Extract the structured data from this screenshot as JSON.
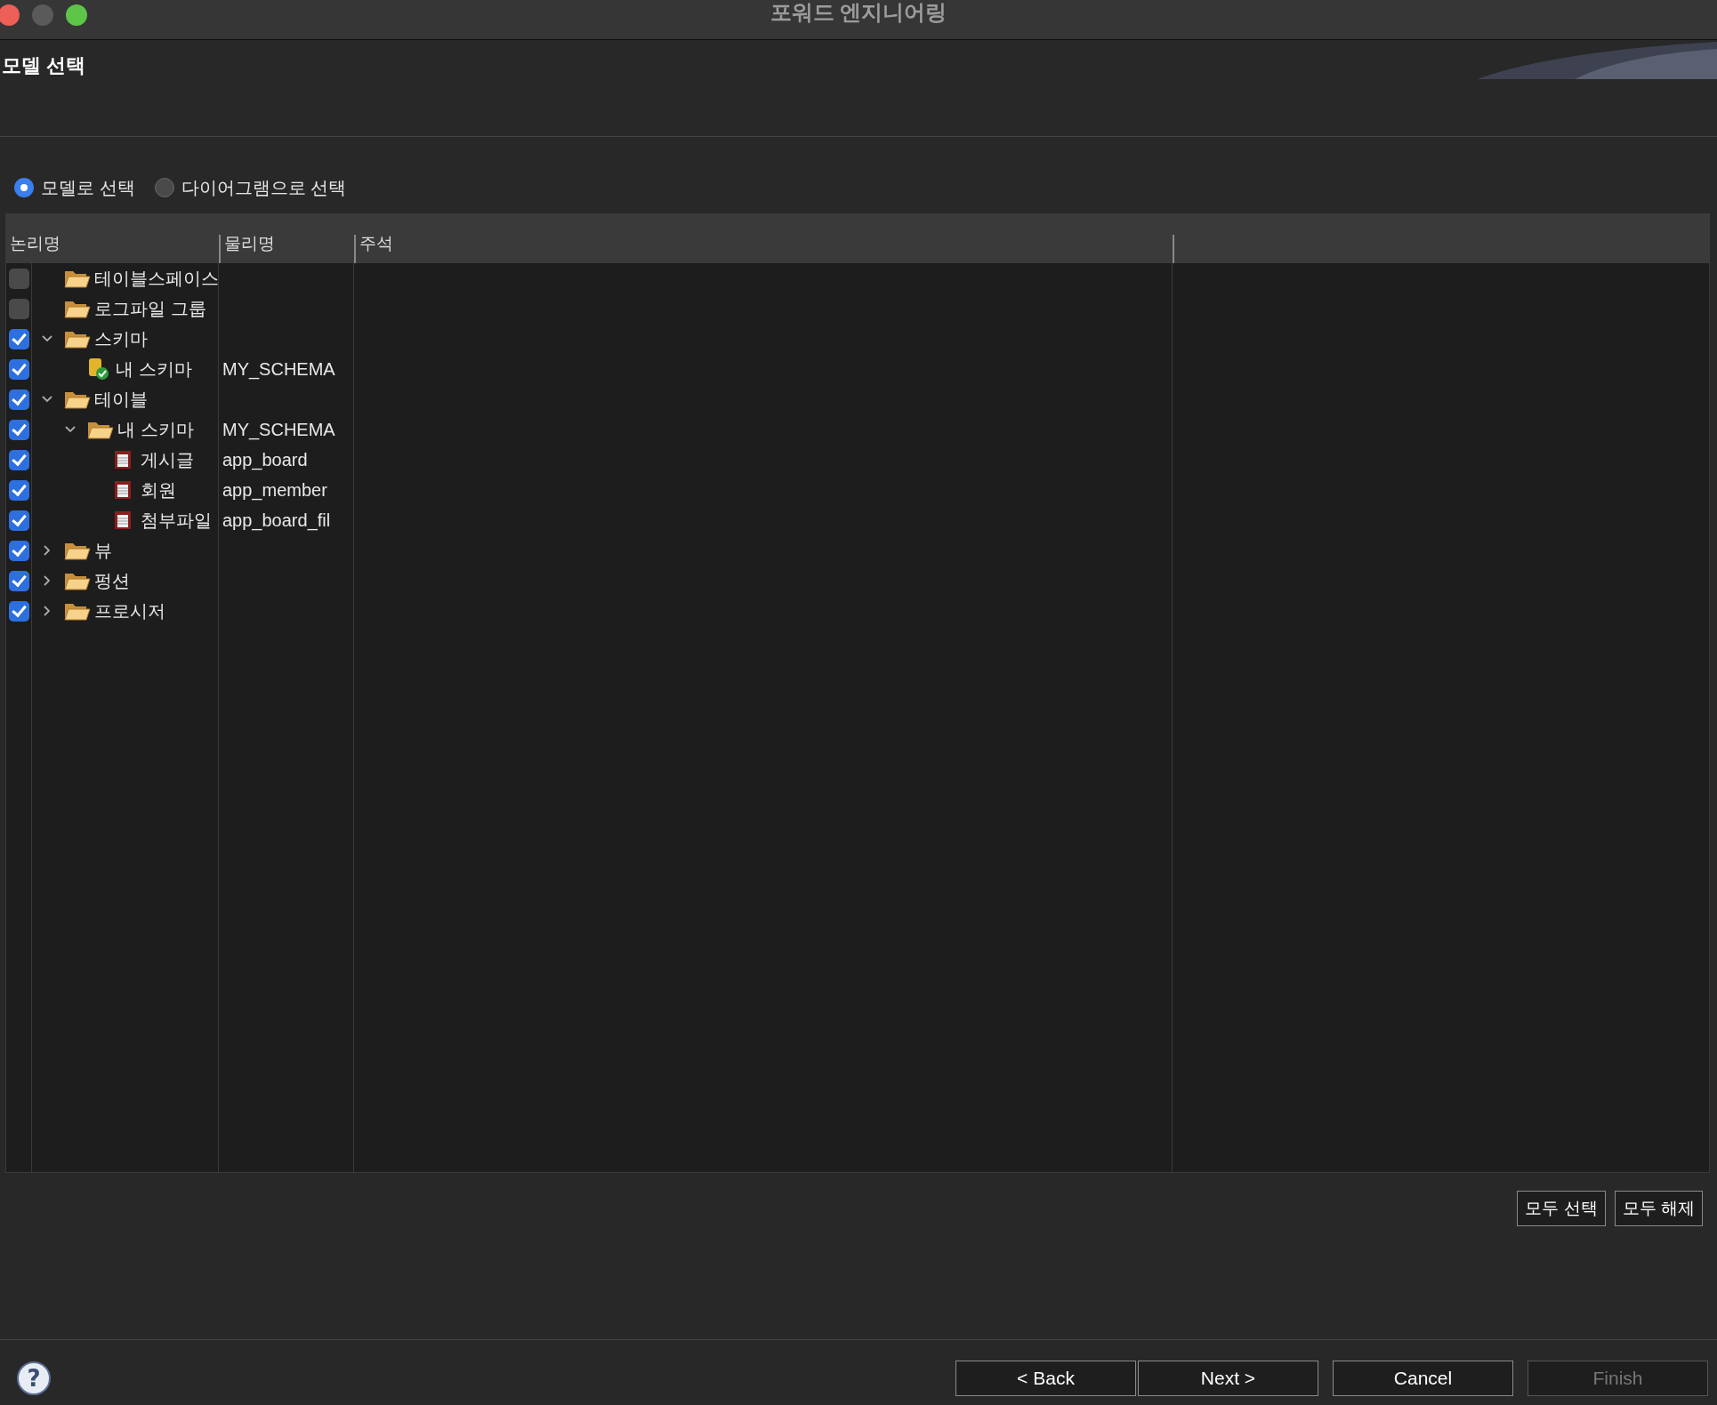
{
  "window": {
    "title": "포워드 엔지니어링"
  },
  "page": {
    "title": "모델 선택"
  },
  "radios": [
    {
      "label": "모델로 선택",
      "selected": true
    },
    {
      "label": "다이어그램으로 선택",
      "selected": false
    }
  ],
  "table": {
    "columns": [
      "논리명",
      "물리명",
      "주석"
    ],
    "rows": [
      {
        "kind": "folder",
        "name": "테이블스페이스",
        "checked": false
      },
      {
        "kind": "folder",
        "name": "로그파일 그룹",
        "checked": false
      },
      {
        "kind": "folder",
        "name": "스키마",
        "checked": true,
        "expanded": true,
        "children": [
          {
            "kind": "schema",
            "name": "내 스키마",
            "physical": "MY_SCHEMA",
            "checked": true
          }
        ]
      },
      {
        "kind": "folder",
        "name": "테이블",
        "checked": true,
        "expanded": true,
        "children": [
          {
            "kind": "folder",
            "name": "내 스키마",
            "physical": "MY_SCHEMA",
            "checked": true,
            "expanded": true,
            "children": [
              {
                "kind": "table",
                "name": "게시글",
                "physical": "app_board",
                "checked": true
              },
              {
                "kind": "table",
                "name": "회원",
                "physical": "app_member",
                "checked": true
              },
              {
                "kind": "table",
                "name": "첨부파일",
                "physical": "app_board_fil",
                "checked": true
              }
            ]
          }
        ]
      },
      {
        "kind": "folder",
        "name": "뷰",
        "checked": true,
        "expanded": false
      },
      {
        "kind": "folder",
        "name": "펑션",
        "checked": true,
        "expanded": false
      },
      {
        "kind": "folder",
        "name": "프로시저",
        "checked": true,
        "expanded": false
      }
    ]
  },
  "help": "?",
  "table_buttons": [
    "모두 선택",
    "모두 해제"
  ],
  "footer_buttons": [
    {
      "label": "< Back",
      "disabled": false
    },
    {
      "label": "Next >",
      "disabled": false
    },
    {
      "label": "Cancel",
      "disabled": false
    },
    {
      "label": "Finish",
      "disabled": true
    }
  ]
}
